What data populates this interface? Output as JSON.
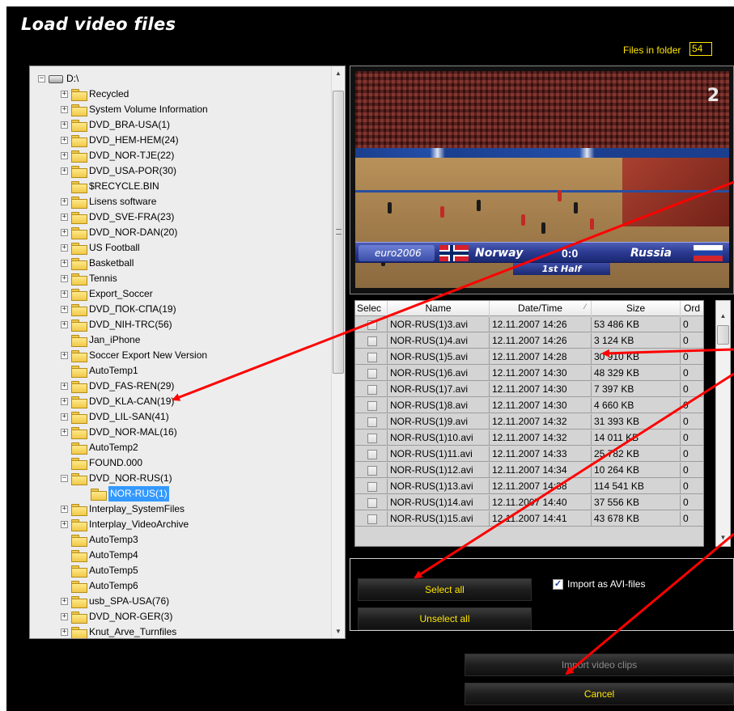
{
  "window": {
    "title": "Load video files",
    "files_in_folder_label": "Files in folder",
    "files_in_folder_value": "54"
  },
  "tree": {
    "root": "D:\\",
    "items": [
      {
        "label": "Recycled",
        "expandable": true
      },
      {
        "label": "System Volume Information",
        "expandable": true
      },
      {
        "label": "DVD_BRA-USA(1)",
        "expandable": true
      },
      {
        "label": "DVD_HEM-HEM(24)",
        "expandable": true
      },
      {
        "label": "DVD_NOR-TJE(22)",
        "expandable": true
      },
      {
        "label": "DVD_USA-POR(30)",
        "expandable": true
      },
      {
        "label": "$RECYCLE.BIN",
        "expandable": false
      },
      {
        "label": "Lisens software",
        "expandable": true
      },
      {
        "label": "DVD_SVE-FRA(23)",
        "expandable": true
      },
      {
        "label": "DVD_NOR-DAN(20)",
        "expandable": true
      },
      {
        "label": "US Football",
        "expandable": true
      },
      {
        "label": "Basketball",
        "expandable": true
      },
      {
        "label": "Tennis",
        "expandable": true
      },
      {
        "label": "Export_Soccer",
        "expandable": true
      },
      {
        "label": "DVD_ПОК-СПА(19)",
        "expandable": true
      },
      {
        "label": "DVD_NIH-TRC(56)",
        "expandable": true
      },
      {
        "label": "Jan_iPhone",
        "expandable": false
      },
      {
        "label": "Soccer Export New Version",
        "expandable": true
      },
      {
        "label": "AutoTemp1",
        "expandable": false
      },
      {
        "label": "DVD_FAS-REN(29)",
        "expandable": true
      },
      {
        "label": "DVD_KLA-CAN(19)",
        "expandable": true
      },
      {
        "label": "DVD_LIL-SAN(41)",
        "expandable": true
      },
      {
        "label": "DVD_NOR-MAL(16)",
        "expandable": true
      },
      {
        "label": "AutoTemp2",
        "expandable": false
      },
      {
        "label": "FOUND.000",
        "expandable": false
      },
      {
        "label": "DVD_NOR-RUS(1)",
        "expandable": true,
        "expanded": true
      },
      {
        "label": "NOR-RUS(1)",
        "expandable": false,
        "child": true,
        "selected": true
      },
      {
        "label": "Interplay_SystemFiles",
        "expandable": true
      },
      {
        "label": "Interplay_VideoArchive",
        "expandable": true
      },
      {
        "label": "AutoTemp3",
        "expandable": false
      },
      {
        "label": "AutoTemp4",
        "expandable": false
      },
      {
        "label": "AutoTemp5",
        "expandable": false
      },
      {
        "label": "AutoTemp6",
        "expandable": false
      },
      {
        "label": "usb_SPA-USA(76)",
        "expandable": true
      },
      {
        "label": "DVD_NOR-GER(3)",
        "expandable": true
      },
      {
        "label": "Knut_Arve_Turnfiles",
        "expandable": true
      }
    ]
  },
  "preview": {
    "channel": "2",
    "logo": "euro2006",
    "team_left": "Norway",
    "score": "0:0",
    "team_right": "Russia",
    "period": "1st Half"
  },
  "table": {
    "columns": [
      "Selec",
      "Name",
      "Date/Time",
      "Size",
      "Ord"
    ],
    "rows": [
      {
        "name": "NOR-RUS(1)3.avi",
        "date": "12.11.2007 14:26",
        "size": "53 486 KB",
        "ord": "0"
      },
      {
        "name": "NOR-RUS(1)4.avi",
        "date": "12.11.2007 14:26",
        "size": "3 124 KB",
        "ord": "0"
      },
      {
        "name": "NOR-RUS(1)5.avi",
        "date": "12.11.2007 14:28",
        "size": "30 910 KB",
        "ord": "0"
      },
      {
        "name": "NOR-RUS(1)6.avi",
        "date": "12.11.2007 14:30",
        "size": "48 329 KB",
        "ord": "0"
      },
      {
        "name": "NOR-RUS(1)7.avi",
        "date": "12.11.2007 14:30",
        "size": "7 397 KB",
        "ord": "0"
      },
      {
        "name": "NOR-RUS(1)8.avi",
        "date": "12.11.2007 14:30",
        "size": "4 660 KB",
        "ord": "0"
      },
      {
        "name": "NOR-RUS(1)9.avi",
        "date": "12.11.2007 14:32",
        "size": "31 393 KB",
        "ord": "0"
      },
      {
        "name": "NOR-RUS(1)10.avi",
        "date": "12.11.2007 14:32",
        "size": "14 011 KB",
        "ord": "0"
      },
      {
        "name": "NOR-RUS(1)11.avi",
        "date": "12.11.2007 14:33",
        "size": "25 782 KB",
        "ord": "0"
      },
      {
        "name": "NOR-RUS(1)12.avi",
        "date": "12.11.2007 14:34",
        "size": "10 264 KB",
        "ord": "0"
      },
      {
        "name": "NOR-RUS(1)13.avi",
        "date": "12.11.2007 14:38",
        "size": "114 541 KB",
        "ord": "0"
      },
      {
        "name": "NOR-RUS(1)14.avi",
        "date": "12.11.2007 14:40",
        "size": "37 556 KB",
        "ord": "0"
      },
      {
        "name": "NOR-RUS(1)15.avi",
        "date": "12.11.2007 14:41",
        "size": "43 678 KB",
        "ord": "0"
      }
    ]
  },
  "options": {
    "select_all": "Select all",
    "unselect_all": "Unselect all",
    "import_avi_label": "Import as AVI-files",
    "import_avi_checked": true
  },
  "actions": {
    "import": "Import video clips",
    "cancel": "Cancel"
  },
  "colors": {
    "accent_yellow": "#ffe600",
    "arrow_red": "#ff0000",
    "selected_blue": "#3399ff"
  }
}
